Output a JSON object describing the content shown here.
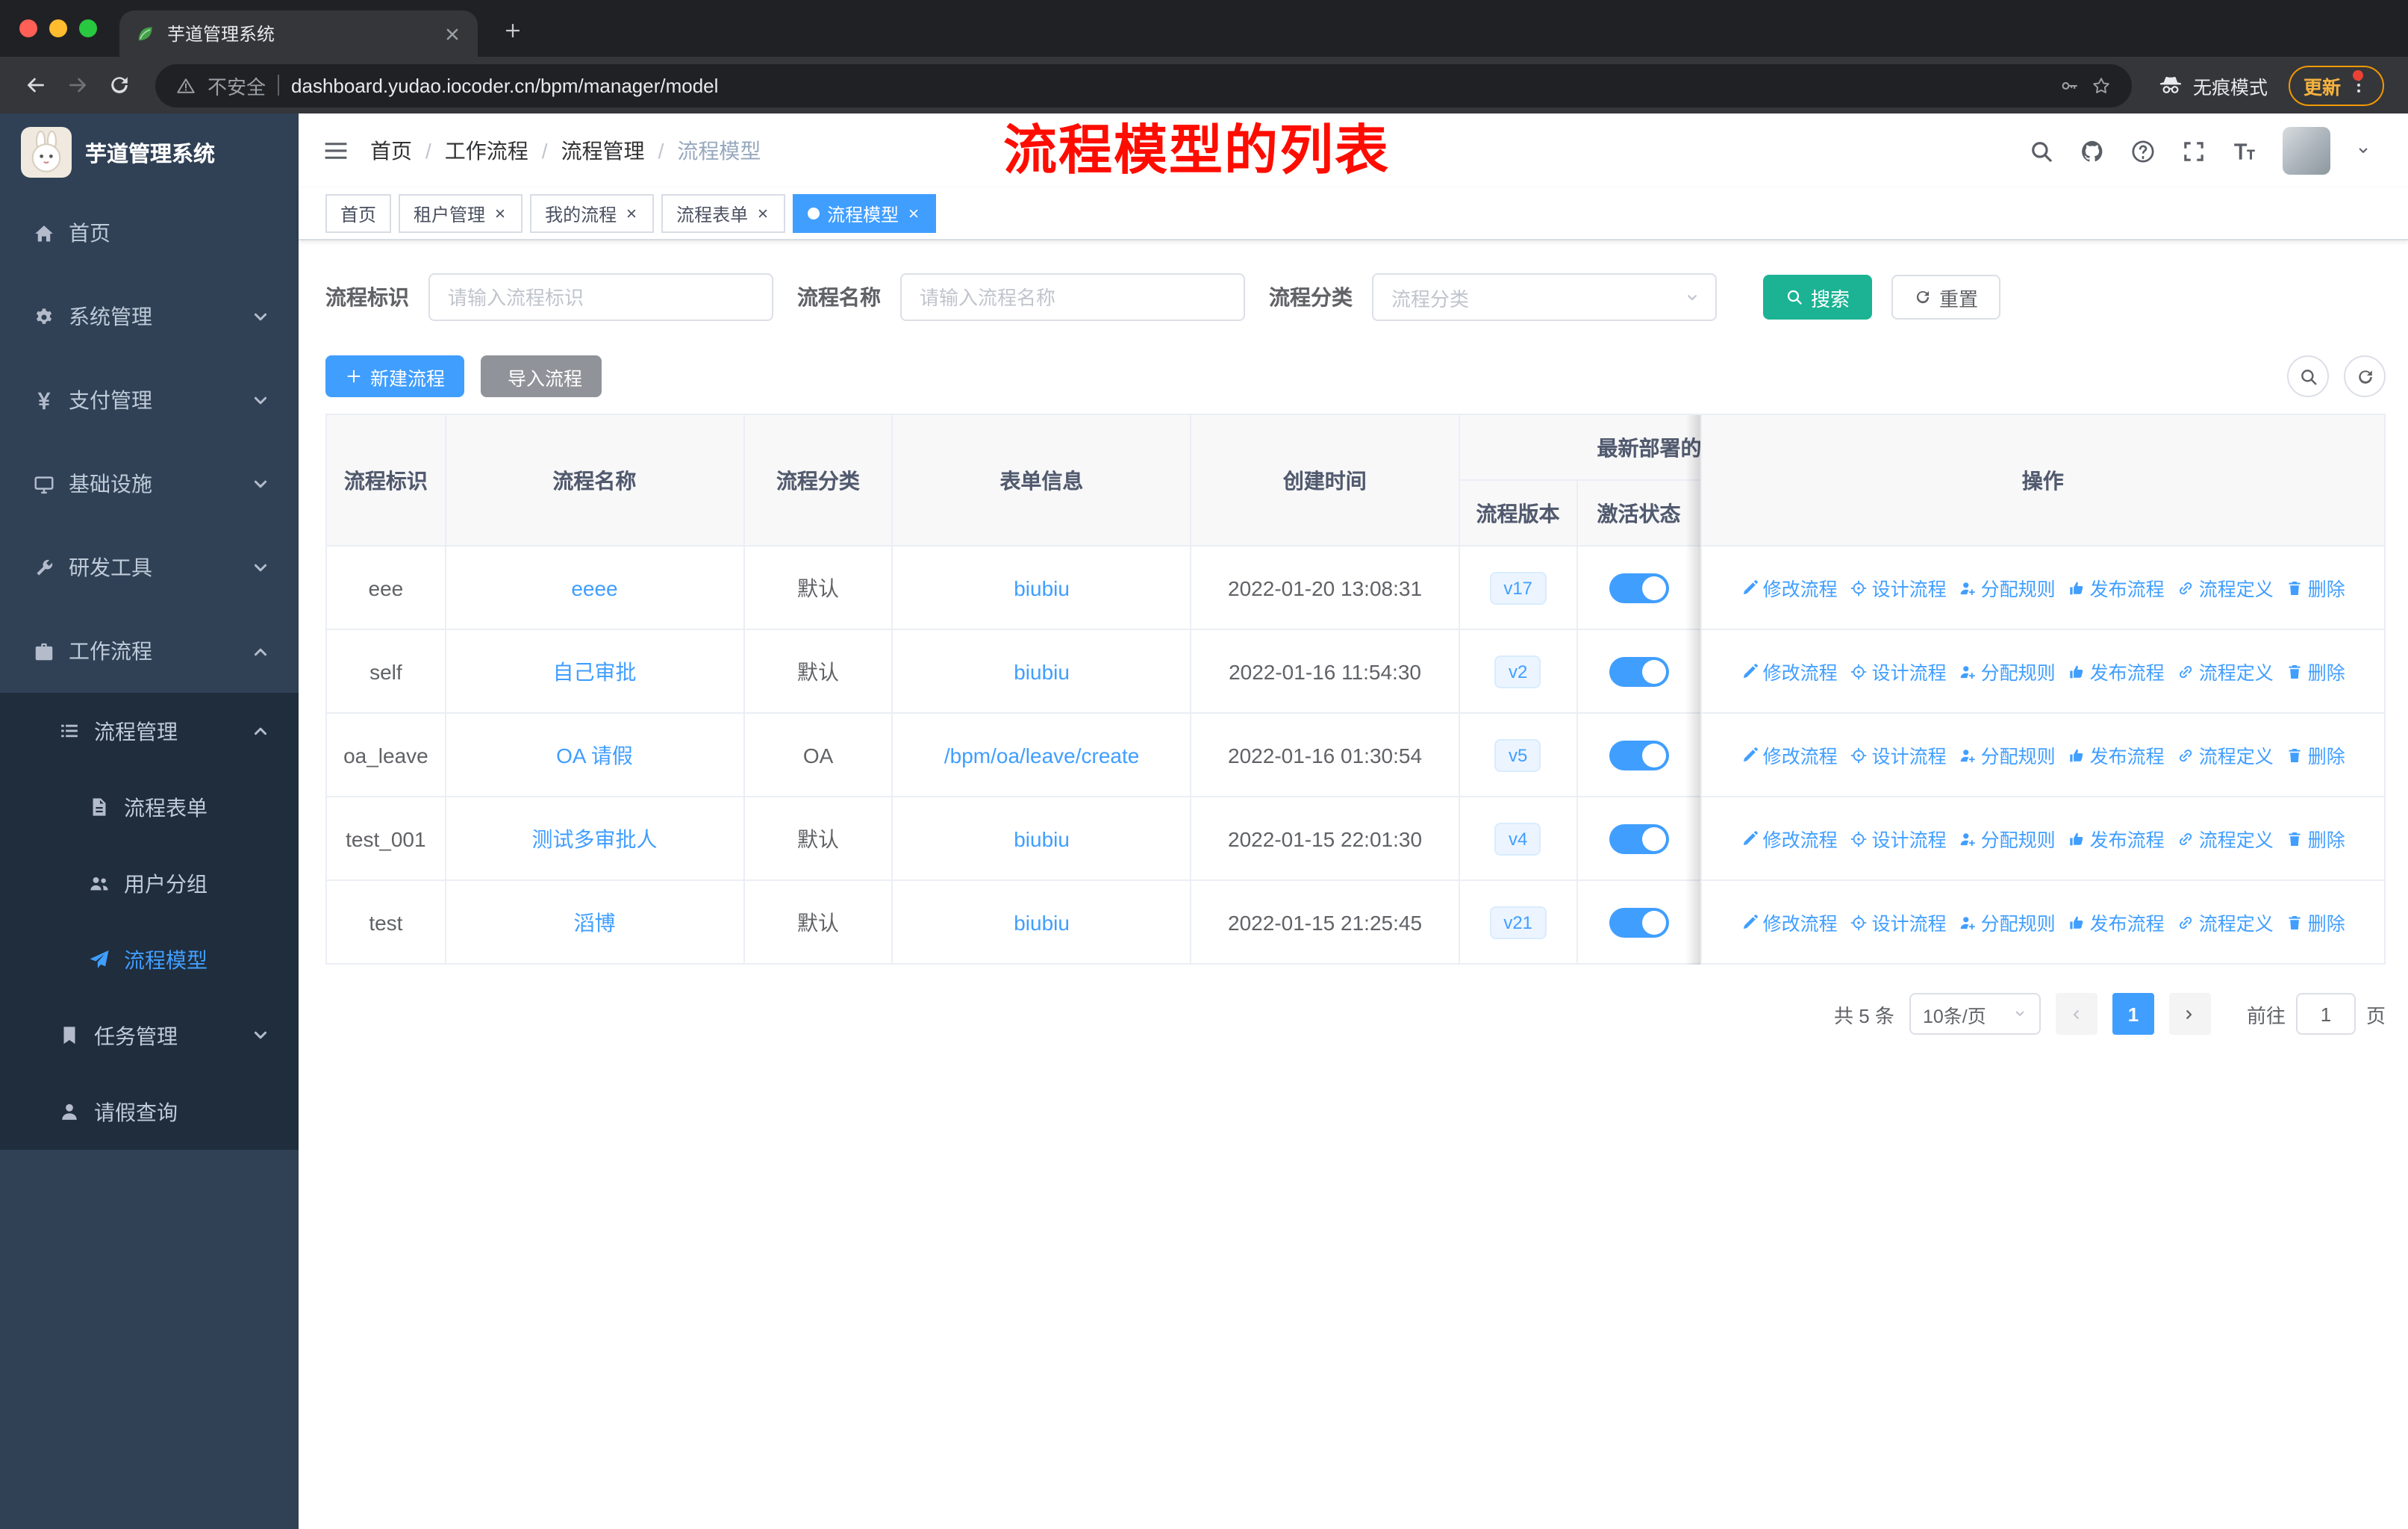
{
  "browser": {
    "traffic_lights": [
      "#ff5f57",
      "#febc2e",
      "#28c840"
    ],
    "tab_title": "芋道管理系统",
    "security_label": "不安全",
    "url": "dashboard.yudao.iocoder.cn/bpm/manager/model",
    "incognito_label": "无痕模式",
    "update_label": "更新"
  },
  "sidebar": {
    "logo_title": "芋道管理系统",
    "menu": [
      {
        "key": "home",
        "label": "首页",
        "icon": "home-icon",
        "level": 1
      },
      {
        "key": "system-mgmt",
        "label": "系统管理",
        "icon": "gear-icon",
        "level": 1,
        "arrow": "down"
      },
      {
        "key": "payment-mgmt",
        "label": "支付管理",
        "icon": "yen-icon",
        "level": 1,
        "arrow": "down"
      },
      {
        "key": "infrastructure",
        "label": "基础设施",
        "icon": "monitor-icon",
        "level": 1,
        "arrow": "down"
      },
      {
        "key": "dev-tools",
        "label": "研发工具",
        "icon": "tool-icon",
        "level": 1,
        "arrow": "down"
      },
      {
        "key": "workflow",
        "label": "工作流程",
        "icon": "briefcase-icon",
        "level": 1,
        "arrow": "up"
      },
      {
        "key": "process-mgmt",
        "label": "流程管理",
        "icon": "list-icon",
        "level": 2,
        "arrow": "up"
      },
      {
        "key": "process-form",
        "label": "流程表单",
        "icon": "document-icon",
        "level": 3
      },
      {
        "key": "user-group",
        "label": "用户分组",
        "icon": "users-icon",
        "level": 3
      },
      {
        "key": "process-model",
        "label": "流程模型",
        "icon": "send-icon",
        "level": 3,
        "active": true
      },
      {
        "key": "task-mgmt",
        "label": "任务管理",
        "icon": "bookmark-icon",
        "level": 2,
        "arrow": "down"
      },
      {
        "key": "leave-query",
        "label": "请假查询",
        "icon": "user-icon",
        "level": 2
      }
    ]
  },
  "header": {
    "breadcrumb": [
      "首页",
      "工作流程",
      "流程管理",
      "流程模型"
    ],
    "annotation": "流程模型的列表",
    "tools": [
      "search-icon",
      "github-icon",
      "question-icon",
      "fullscreen-icon",
      "font-size-icon"
    ]
  },
  "tags": [
    {
      "key": "home",
      "label": "首页",
      "closable": false,
      "active": false
    },
    {
      "key": "tenant-mgmt",
      "label": "租户管理",
      "closable": true,
      "active": false
    },
    {
      "key": "my-process",
      "label": "我的流程",
      "closable": true,
      "active": false
    },
    {
      "key": "process-form",
      "label": "流程表单",
      "closable": true,
      "active": false
    },
    {
      "key": "process-model",
      "label": "流程模型",
      "closable": true,
      "active": true
    }
  ],
  "filters": {
    "id_label": "流程标识",
    "id_placeholder": "请输入流程标识",
    "name_label": "流程名称",
    "name_placeholder": "请输入流程名称",
    "category_label": "流程分类",
    "category_placeholder": "流程分类",
    "search_label": "搜索",
    "reset_label": "重置"
  },
  "toolbar": {
    "create_label": "新建流程",
    "import_label": "导入流程"
  },
  "table": {
    "header": {
      "id": "流程标识",
      "name": "流程名称",
      "category": "流程分类",
      "form": "表单信息",
      "created": "创建时间",
      "deploy_group": "最新部署的",
      "version": "流程版本",
      "active": "激活状态",
      "ops": "操作"
    },
    "actions": [
      {
        "key": "modify",
        "label": "修改流程",
        "icon": "edit-icon"
      },
      {
        "key": "design",
        "label": "设计流程",
        "icon": "design-icon"
      },
      {
        "key": "assign-rule",
        "label": "分配规则",
        "icon": "assign-icon"
      },
      {
        "key": "publish",
        "label": "发布流程",
        "icon": "publish-icon"
      },
      {
        "key": "definition",
        "label": "流程定义",
        "icon": "link-icon"
      },
      {
        "key": "delete",
        "label": "删除",
        "icon": "delete-icon"
      }
    ],
    "rows": [
      {
        "id": "eee",
        "name": "eeee",
        "category": "默认",
        "form": "biubiu",
        "created": "2022-01-20 13:08:31",
        "version": "v17",
        "active": true
      },
      {
        "id": "self",
        "name": "自己审批",
        "category": "默认",
        "form": "biubiu",
        "created": "2022-01-16 11:54:30",
        "version": "v2",
        "active": true
      },
      {
        "id": "oa_leave",
        "name": "OA 请假",
        "category": "OA",
        "form": "/bpm/oa/leave/create",
        "created": "2022-01-16 01:30:54",
        "version": "v5",
        "active": true
      },
      {
        "id": "test_001",
        "name": "测试多审批人",
        "category": "默认",
        "form": "biubiu",
        "created": "2022-01-15 22:01:30",
        "version": "v4",
        "active": true
      },
      {
        "id": "test",
        "name": "滔博",
        "category": "默认",
        "form": "biubiu",
        "created": "2022-01-15 21:25:45",
        "version": "v21",
        "active": true
      }
    ]
  },
  "pagination": {
    "total": "共 5 条",
    "page_size": "10条/页",
    "current_page": "1",
    "goto_label": "前往",
    "goto_value": "1",
    "page_unit": "页"
  },
  "colors": {
    "accent": "#409eff",
    "search_button": "#1bb394",
    "import_button": "#909399",
    "sidebar_bg": "#304156",
    "submenu_bg": "#1f2d3d",
    "annotation_red": "#fe0c00",
    "link": "#409eff",
    "tag_version_bg": "#ecf5ff"
  }
}
